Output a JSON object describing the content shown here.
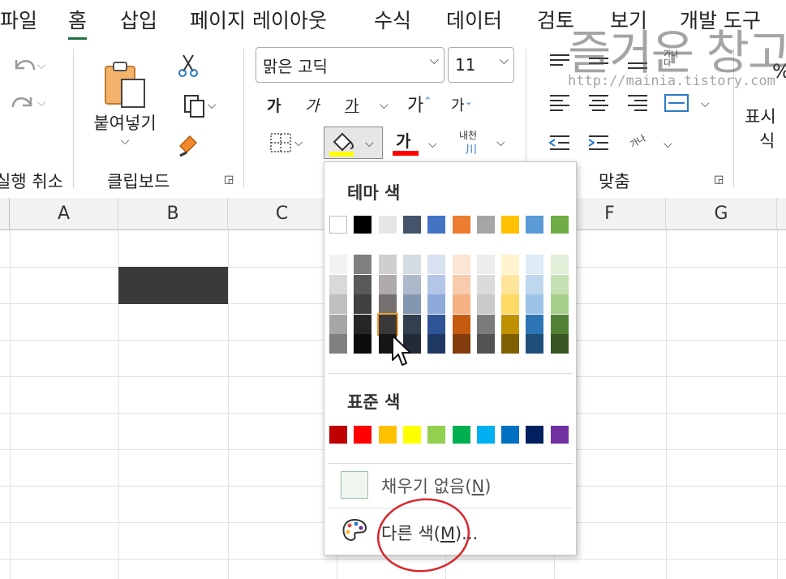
{
  "menu": {
    "tabs": [
      {
        "label": "파일"
      },
      {
        "label": "홈",
        "active": true
      },
      {
        "label": "삽입"
      },
      {
        "label": "페이지 레이아웃"
      },
      {
        "label": "수식"
      },
      {
        "label": "데이터"
      },
      {
        "label": "검토"
      },
      {
        "label": "보기"
      },
      {
        "label": "개발 도구"
      }
    ]
  },
  "ribbon": {
    "undo_group_label": "실행 취소",
    "clipboard": {
      "label": "클립보드",
      "paste_label_line1": "붙여넣기"
    },
    "font": {
      "name": "맑은 고딕",
      "size": "11",
      "bold_glyph": "가",
      "italic_glyph": "가",
      "underline_glyph": "가",
      "grow_glyph": "가",
      "shrink_glyph": "가",
      "font_color_glyph": "가",
      "phonetic_glyph_top": "내천",
      "phonetic_glyph_bottom": "川",
      "fill_color": "#ffff00",
      "font_color": "#ff0000"
    },
    "alignment": {
      "label": "맞춤",
      "orientation_glyph": "가나",
      "wrap_glyph_top": "가나",
      "wrap_glyph_bottom": "다"
    },
    "number": {
      "label_line1": "표시",
      "label_line2": "식",
      "percent": "%"
    }
  },
  "sheet": {
    "columns": [
      "A",
      "B",
      "C",
      "D",
      "E",
      "F",
      "G"
    ],
    "filled_cell": {
      "ref": "B2",
      "color": "#3a3a3a"
    }
  },
  "fill_dropdown": {
    "theme_title": "테마 색",
    "theme_top_row": [
      "#ffffff",
      "#000000",
      "#e7e6e6",
      "#44546a",
      "#4472c4",
      "#ed7d31",
      "#a5a5a5",
      "#ffc000",
      "#5b9bd5",
      "#70ad47"
    ],
    "theme_shades": [
      [
        "#f2f2f2",
        "#d9d9d9",
        "#bfbfbf",
        "#a6a6a6",
        "#808080"
      ],
      [
        "#808080",
        "#595959",
        "#404040",
        "#262626",
        "#0d0d0d"
      ],
      [
        "#d0cece",
        "#aeaaaa",
        "#757171",
        "#3a3838",
        "#171616"
      ],
      [
        "#d6dce4",
        "#adb9ca",
        "#8497b0",
        "#333f4f",
        "#222a35"
      ],
      [
        "#d9e2f3",
        "#b4c6e7",
        "#8eaadb",
        "#2f5496",
        "#1f3864"
      ],
      [
        "#fbe5d5",
        "#f7cbac",
        "#f4b183",
        "#c55a11",
        "#833c0b"
      ],
      [
        "#ededed",
        "#dbdbdb",
        "#c9c9c9",
        "#7b7b7b",
        "#525252"
      ],
      [
        "#fff2cc",
        "#fee599",
        "#ffd965",
        "#bf9000",
        "#7f6000"
      ],
      [
        "#deebf6",
        "#bdd7ee",
        "#9dc3e6",
        "#2e75b5",
        "#1f4e79"
      ],
      [
        "#e2efd9",
        "#c5e0b3",
        "#a8d08d",
        "#538135",
        "#375623"
      ]
    ],
    "selected_shade": {
      "column": 2,
      "row": 3
    },
    "standard_title": "표준 색",
    "standard_colors": [
      "#c00000",
      "#ff0000",
      "#ffc000",
      "#ffff00",
      "#92d050",
      "#00b050",
      "#00b0f0",
      "#0070c0",
      "#002060",
      "#7030a0"
    ],
    "no_fill_label": "채우기 없음(",
    "no_fill_key": "N",
    "no_fill_close": ")",
    "more_colors_label": "다른 색(",
    "more_colors_key": "M",
    "more_colors_close": ")..."
  },
  "watermark": {
    "title": "즐거운 창고",
    "url": "http://mainia.tistory.com"
  }
}
